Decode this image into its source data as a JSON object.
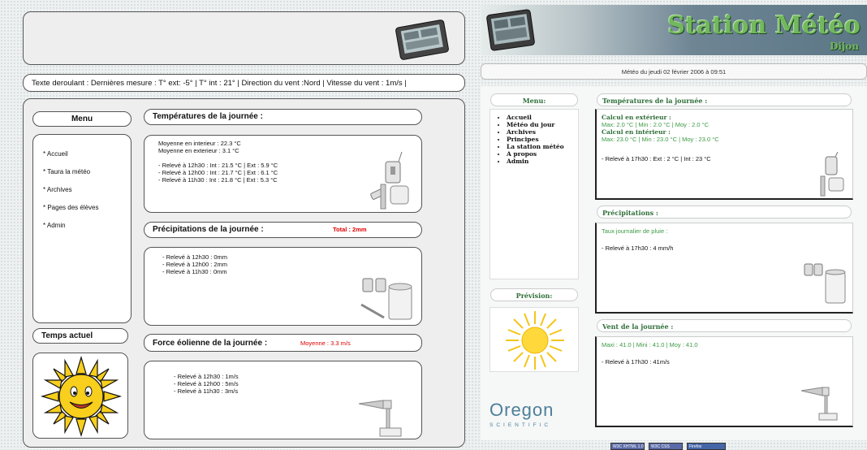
{
  "left": {
    "ticker": "Texte deroulant : Dernières mesure : T° ext: -5° | T° int : 21° | Direction du vent :Nord | Vitesse du vent : 1m/s |",
    "menu_title": "Menu",
    "menu_items": [
      "* Accueil",
      "* Taura la météo",
      "* Archives",
      "* Pages des élèves",
      "* Admin"
    ],
    "current_weather_title": "Temps actuel",
    "temp_section": {
      "title": "Températures de la journée :",
      "lines": [
        "Moyenne en interieur : 22.3 °C",
        "Moyenne en exterieur : 3.1 °C",
        "",
        "- Relevé à 12h30 : Int : 21.5 °C | Ext : 5.9 °C",
        "- Relevé à 12h00 : Int : 21.7 °C | Ext : 6.1 °C",
        "- Relevé à 11h30 : Int : 21.8 °C | Ext : 5.3 °C"
      ]
    },
    "rain_section": {
      "title": "Précipitations de la journée :",
      "total": "Total : 2mm",
      "lines": [
        "- Relevé à 12h30 : 0mm",
        "- Relevé à 12h00 : 2mm",
        "- Relevé à 11h30 : 0mm"
      ]
    },
    "wind_section": {
      "title": "Force éolienne de la journée :",
      "average": "Moyenne : 3.3 m/s",
      "lines": [
        "- Relevé à 12h30 : 1m/s",
        "- Relevé à 12h00 : 5m/s",
        "- Relevé à 11h30 : 3m/s"
      ]
    }
  },
  "right": {
    "title": "Station Météo",
    "subtitle": "Dijon",
    "date": "Météo du  jeudi 02 février 2006 à 09:51",
    "menu_title": "Menu:",
    "menu_items": [
      "Accueil",
      "Météo du jour",
      "Archives",
      "Principes",
      "La station météo",
      "A propos",
      "Admin"
    ],
    "forecast_title": "Prévision:",
    "brand": "Oregon",
    "brand_sub": "SCIENTIFIC",
    "temp_section": {
      "title": "Températures de la journée :",
      "ext_label": "Calcul en extérieur :",
      "ext_values": "Max: 2.0 °C | Min : 2.0 °C | Moy : 2.0 °C",
      "int_label": "Calcul en intérieur :",
      "int_values": "Max: 23.0 °C | Min : 23.0 °C | Moy : 23.0 °C",
      "reading": "- Relevé à 17h30 : Ext : 2 °C | Int : 23 °C"
    },
    "rain_section": {
      "title": "Précipitations :",
      "label": "Taux journalier de pluie :",
      "reading": "- Relevé à 17h30 : 4 mm/h"
    },
    "wind_section": {
      "title": "Vent de la journée :",
      "values": "Maxi : 41.0 | Mini : 41.0 | Moy : 41.0",
      "reading": "- Relevé à 17h30 : 41m/s"
    },
    "badges": [
      "W3C XHTML 1.0",
      "W3C CSS",
      "Firefox"
    ]
  },
  "colors": {
    "accent_red": "#e00000",
    "green_text": "#3c9a44",
    "dark_green": "#2f6f39",
    "title_green": "#72b85c"
  }
}
